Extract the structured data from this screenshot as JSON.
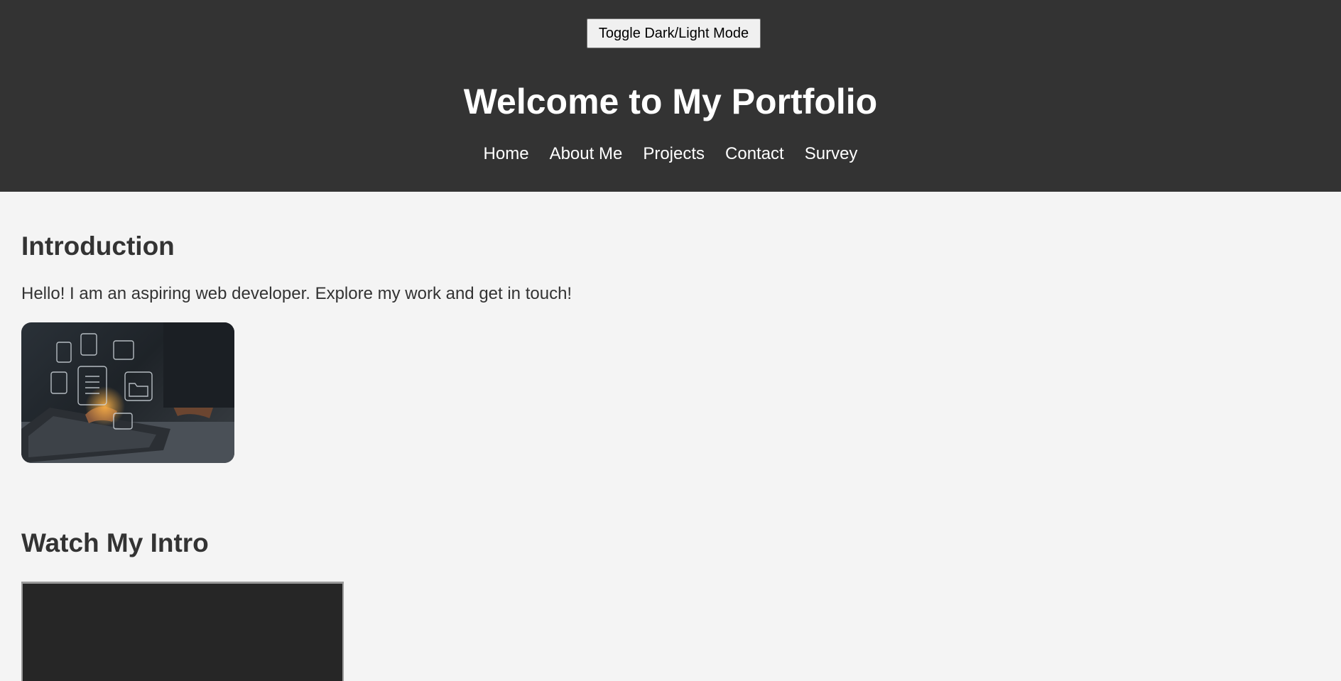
{
  "header": {
    "toggle_label": "Toggle Dark/Light Mode",
    "title": "Welcome to My Portfolio",
    "nav": [
      "Home",
      "About Me",
      "Projects",
      "Contact",
      "Survey"
    ]
  },
  "intro": {
    "heading": "Introduction",
    "text": "Hello! I am an aspiring web developer. Explore my work and get in touch!",
    "image_icon": "laptop-digital-documents-photo"
  },
  "video": {
    "heading": "Watch My Intro"
  },
  "colors": {
    "header_bg": "#333333",
    "page_bg": "#f4f4f4",
    "text": "#333333",
    "header_text": "#ffffff",
    "video_bg": "#262626"
  }
}
